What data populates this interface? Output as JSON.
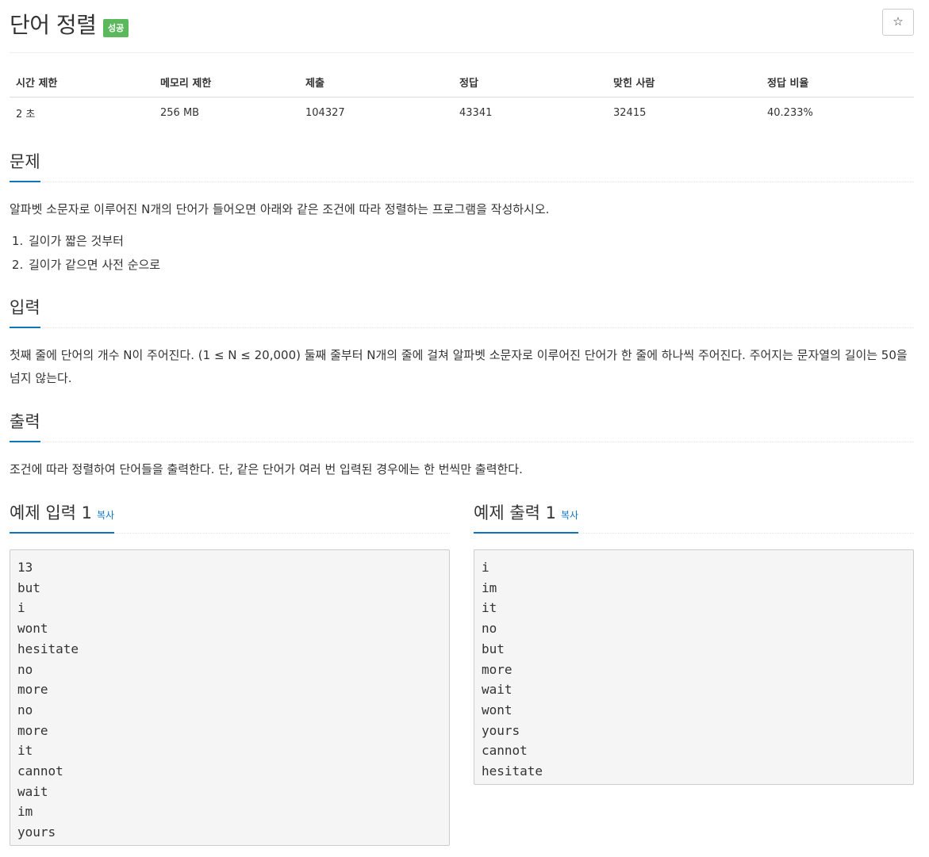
{
  "problem": {
    "title": "단어 정렬",
    "badge": "성공",
    "star": "☆"
  },
  "info": {
    "headers": [
      "시간 제한",
      "메모리 제한",
      "제출",
      "정답",
      "맞힌 사람",
      "정답 비율"
    ],
    "values": [
      "2 초",
      "256 MB",
      "104327",
      "43341",
      "32415",
      "40.233%"
    ]
  },
  "description": {
    "heading": "문제",
    "text": "알파벳 소문자로 이루어진 N개의 단어가 들어오면 아래와 같은 조건에 따라 정렬하는 프로그램을 작성하시오.",
    "items": [
      "길이가 짧은 것부터",
      "길이가 같으면 사전 순으로"
    ]
  },
  "input": {
    "heading": "입력",
    "text": "첫째 줄에 단어의 개수 N이 주어진다. (1 ≤ N ≤ 20,000) 둘째 줄부터 N개의 줄에 걸쳐 알파벳 소문자로 이루어진 단어가 한 줄에 하나씩 주어진다. 주어지는 문자열의 길이는 50을 넘지 않는다."
  },
  "output": {
    "heading": "출력",
    "text": "조건에 따라 정렬하여 단어들을 출력한다. 단, 같은 단어가 여러 번 입력된 경우에는 한 번씩만 출력한다."
  },
  "samples": {
    "input_title": "예제 입력 1",
    "output_title": "예제 출력 1",
    "copy_label": "복사",
    "input_text": "13\nbut\ni\nwont\nhesitate\nno\nmore\nno\nmore\nit\ncannot\nwait\nim\nyours",
    "output_text": "i\nim\nit\nno\nbut\nmore\nwait\nwont\nyours\ncannot\nhesitate"
  }
}
